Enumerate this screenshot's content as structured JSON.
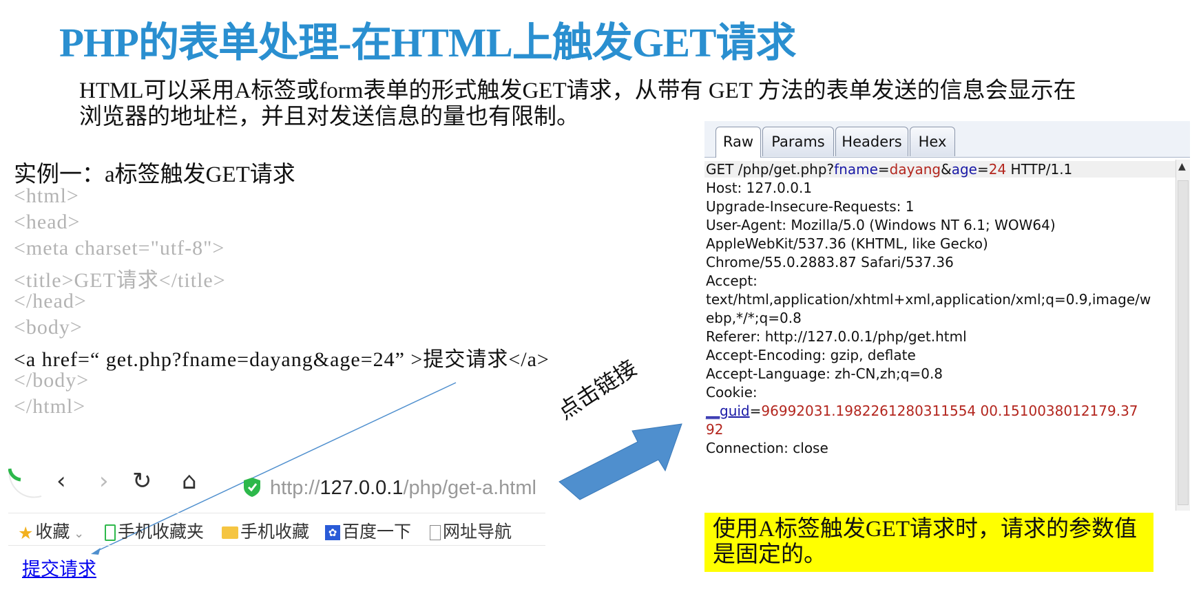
{
  "slide": {
    "title": "PHP的表单处理-在HTML上触发GET请求",
    "intro": "HTML可以采用A标签或form表单的形式触发GET请求，从带有 GET 方法的表单发送的信息会显示在浏览器的地址栏，并且对发送信息的量也有限制。",
    "example_heading": "实例一：a标签触发GET请求",
    "code_lines": [
      "<html>",
      "<head>",
      "<meta charset=\"utf-8\">",
      "<title>GET请求</title>",
      "</head>",
      "<body>",
      "<a href=“ get.php?fname=dayang&age=24” >提交请求</a>",
      "</body>",
      "</html>"
    ],
    "arrow_label": "点击链接",
    "note": "使用A标签触发GET请求时，请求的参数值是固定的。"
  },
  "browser": {
    "back": "‹",
    "forward": "›",
    "reload": "↻",
    "home": "⌂",
    "url_scheme": "http://",
    "url_host": "127.0.0.1",
    "url_path": "/php/get-a.html",
    "bookmarks": [
      "收藏",
      "手机收藏夹",
      "手机收藏",
      "百度一下",
      "网址导航"
    ],
    "link_text": "提交请求"
  },
  "burp": {
    "tabs": [
      "Raw",
      "Params",
      "Headers",
      "Hex"
    ],
    "selected_tab": "Raw",
    "request_line": {
      "prefix": "GET /php/get.php?",
      "k1": "fname",
      "eq1": "=",
      "v1": "dayang",
      "amp": "&",
      "k2": "age",
      "eq2": "=",
      "v2": "24",
      "suffix": " HTTP/1.1"
    },
    "lines": [
      "Host: 127.0.0.1",
      "Upgrade-Insecure-Requests: 1",
      "User-Agent: Mozilla/5.0 (Windows NT 6.1; WOW64)",
      "AppleWebKit/537.36 (KHTML, like Gecko)",
      "Chrome/55.0.2883.87 Safari/537.36",
      "Accept:",
      "text/html,application/xhtml+xml,application/xml;q=0.9,image/w",
      "ebp,*/*;q=0.8",
      "Referer: http://127.0.0.1/php/get.html",
      "Accept-Encoding: gzip, deflate",
      "Accept-Language: zh-CN,zh;q=0.8",
      "Cookie:"
    ],
    "cookie": {
      "key": "__guid",
      "eq": "=",
      "value1": "96992031.1982261280311554 00.1510038012179.37",
      "value2": "92"
    },
    "last_line": "Connection: close"
  },
  "colors": {
    "title": "#2a8fd0",
    "arrow": "#4f8fce",
    "note_bg": "#ffff00"
  }
}
